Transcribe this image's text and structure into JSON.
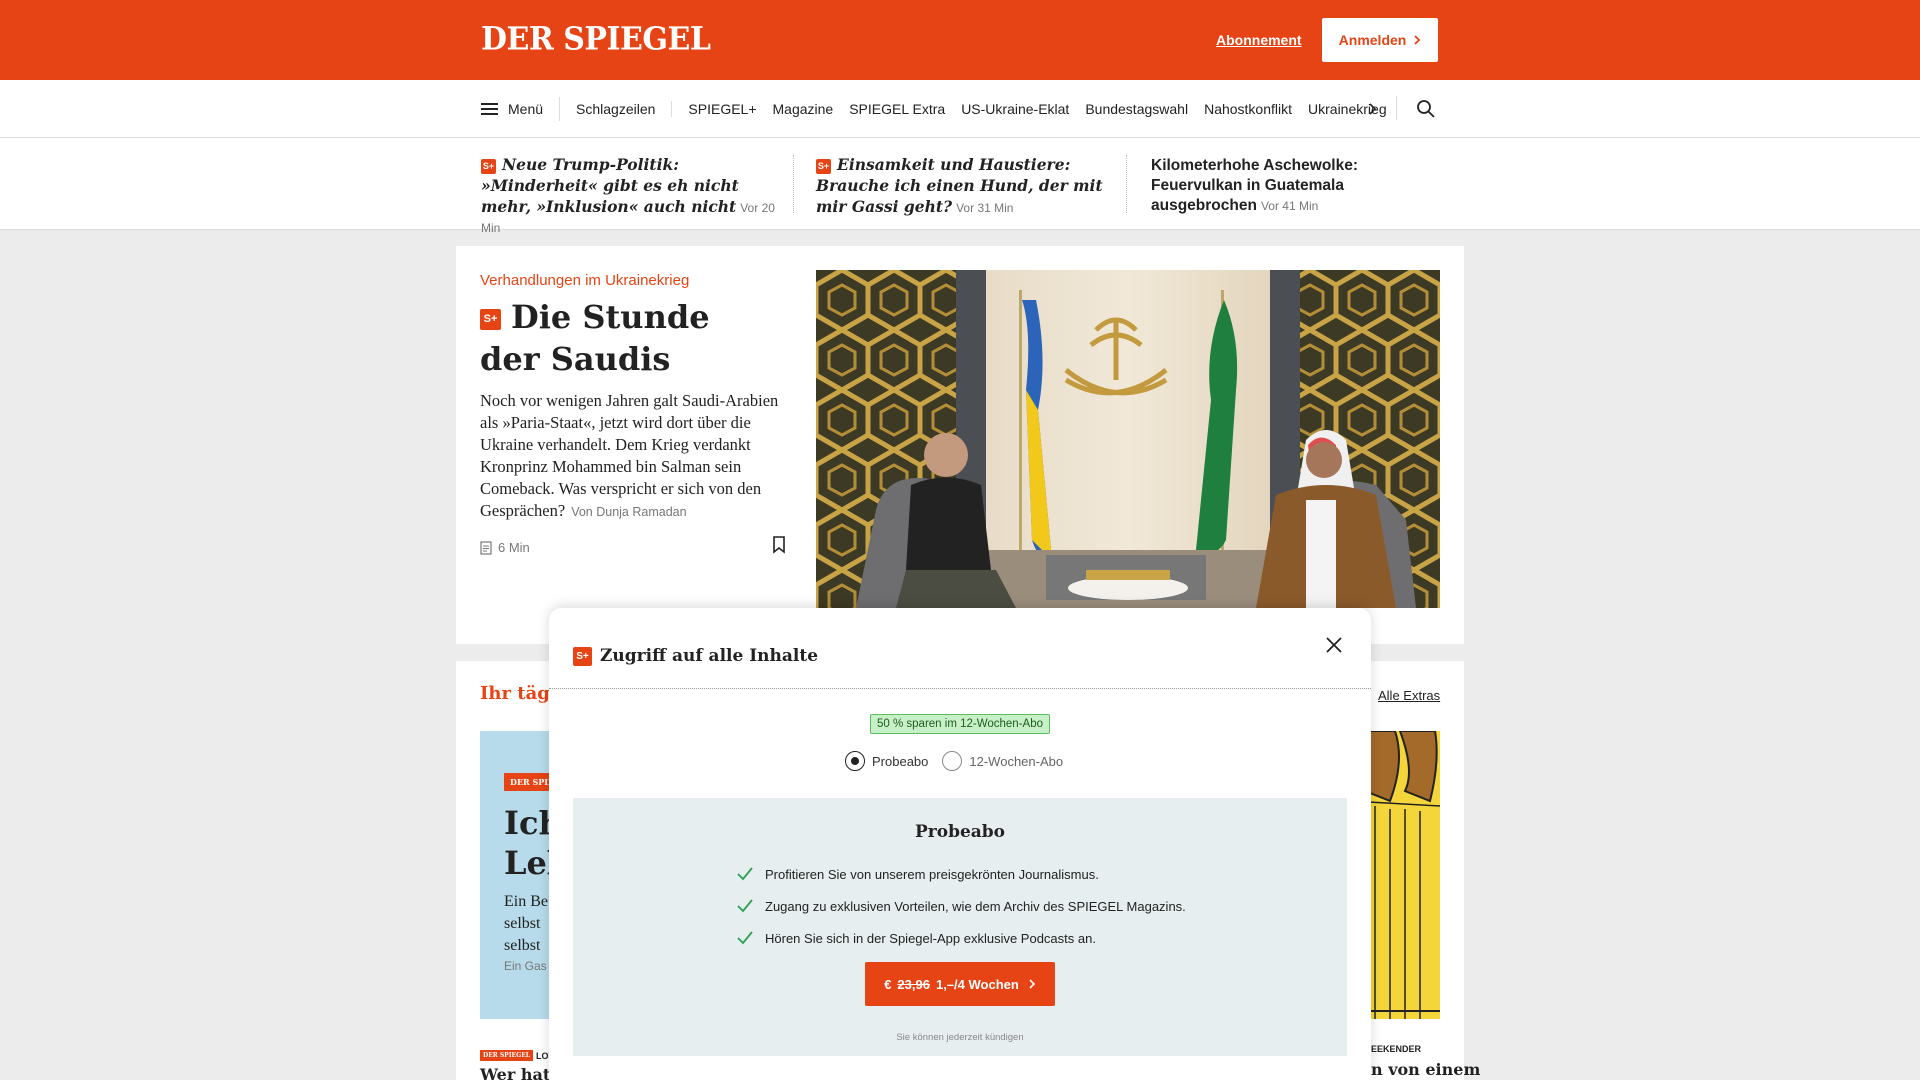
{
  "header": {
    "logo": "DER SPIEGEL",
    "subscription_link": "Abonnement",
    "login_button": "Anmelden",
    "brand_color": "#e64415"
  },
  "nav": {
    "menu_label": "Menü",
    "items": [
      "Schlagzeilen",
      "SPIEGEL+",
      "Magazine",
      "SPIEGEL Extra",
      "US-Ukraine-Eklat",
      "Bundestagswahl",
      "Nahostkonflikt",
      "Ukrainekrieg"
    ],
    "icons": [
      "hamburger-icon",
      "chevron-right-icon",
      "search-icon"
    ]
  },
  "strip": [
    {
      "plus": true,
      "headline": "Neue Trump-Politik: »Minderheit« gibt es eh nicht mehr, »Inklusion« auch nicht",
      "time": "Vor 20 Min"
    },
    {
      "plus": true,
      "headline": "Einsamkeit und Haustiere: Brauche ich einen Hund, der mit mir Gassi geht?",
      "time": "Vor 31 Min"
    },
    {
      "plus": false,
      "headline": "Kilometerhohe Aschewolke: Feuervulkan in Guatemala ausgebrochen",
      "time": "Vor 41 Min"
    }
  ],
  "main_article": {
    "kicker": "Verhandlungen im Ukrainekrieg",
    "plus_badge": "S+",
    "title": "Die Stunde der Saudis",
    "teaser": "Noch vor wenigen Jahren galt Saudi-Arabien als »Paria-Staat«, jetzt wird dort über die Ukraine verhandelt. Dem Krieg verdankt Kronprinz Mohammed bin Salman sein Comeback. Was verspricht er sich von den Gesprächen?",
    "author": "Von Dunja Ramadan",
    "read_time": "6 Min"
  },
  "second_section": {
    "title": "Ihr täglic",
    "all_extras": "Alle Extras",
    "promo_brand": "DER SPIE",
    "promo_title_line1": "Ich",
    "promo_title_line2": "Leb",
    "promo_text_lines": [
      "Ein Be",
      "selbst",
      "selbst"
    ],
    "promo_sub": "Ein Gas",
    "bottom_left_brand": "DER SPIEGEL",
    "bottom_left_tag": "LOVE",
    "bottom_left_title": "Wer hat A",
    "bottom_right_tag": "EEKENDER",
    "bottom_right_title": "n von einem"
  },
  "modal": {
    "title": "Zugriff auf alle Inhalte",
    "plus_badge": "S+",
    "save_badge": "50 % sparen im 12-Wochen-Abo",
    "options": [
      {
        "label": "Probeabo",
        "selected": true
      },
      {
        "label": "12-Wochen-Abo",
        "selected": false
      }
    ],
    "plan_title": "Probeabo",
    "features": [
      "Profitieren Sie von unserem preisgekrönten Journalismus.",
      "Zugang zu exklusiven Vorteilen, wie dem Archiv des SPIEGEL Magazins.",
      "Hören Sie sich in der Spiegel-App exklusive Podcasts an."
    ],
    "cta_currency": "€",
    "cta_old_price": "23,96",
    "cta_new_price": "1,–/4 Wochen",
    "cancel_note": "Sie können jederzeit kündigen",
    "check_color": "#2e9e4f"
  }
}
